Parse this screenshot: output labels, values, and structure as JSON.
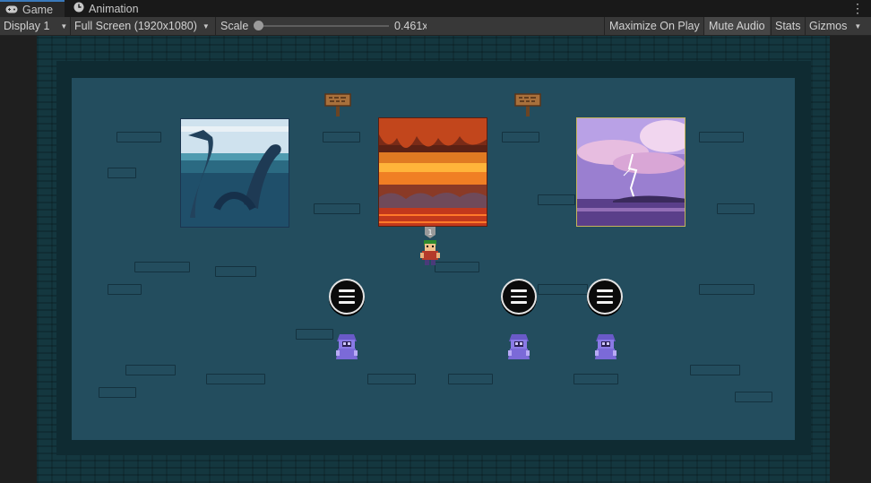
{
  "tabs": [
    {
      "label": "Game",
      "icon": "gamepad-icon",
      "active": true
    },
    {
      "label": "Animation",
      "icon": "clock-icon",
      "active": false
    }
  ],
  "toolbar": {
    "display": "Display 1",
    "resolution": "Full Screen (1920x1080)",
    "scale_label": "Scale",
    "scale_value": "0.461x",
    "maximize_on_play": "Maximize On Play",
    "mute_audio": "Mute Audio",
    "stats": "Stats",
    "gizmos": "Gizmos"
  },
  "scene": {
    "paintings": [
      {
        "name": "sea-serpent-painting",
        "subject": "sea serpent in ocean"
      },
      {
        "name": "lava-cave-painting",
        "subject": "lava cavern"
      },
      {
        "name": "lightning-storm-painting",
        "subject": "pink lightning storm over sea"
      }
    ],
    "player_badge": "1",
    "colors": {
      "floor": "#234d5e",
      "wall": "#14373f",
      "accent_tab": "#3a79bb"
    }
  }
}
